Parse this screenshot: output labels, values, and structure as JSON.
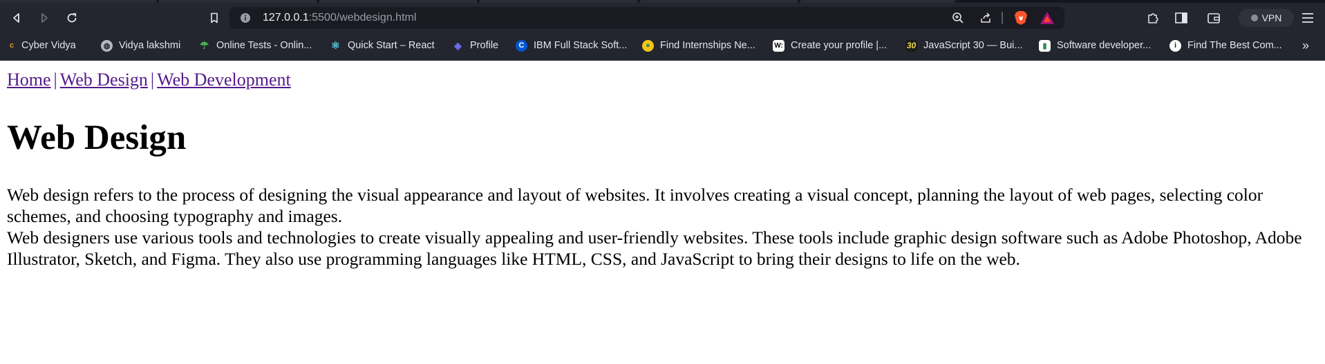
{
  "browser": {
    "url_host": "127.0.0.1",
    "url_path": ":5500/webdesign.html",
    "vpn_label": "VPN",
    "icons": [
      "back-icon",
      "forward-icon",
      "reload-icon",
      "bookmark-icon",
      "site-info-icon",
      "zoom-icon",
      "share-icon",
      "brave-shields-icon",
      "brave-rewards-icon",
      "extensions-icon",
      "sidebar-icon",
      "wallet-icon",
      "menu-icon"
    ],
    "bookmarks": [
      {
        "label": "Cyber Vidya",
        "icon": "cybervidya-icon",
        "color": "#e0a030"
      },
      {
        "label": "Vidya lakshmi",
        "icon": "globe-icon",
        "color": "#b5b7c0"
      },
      {
        "label": "Online Tests - Onlin...",
        "icon": "onlinetests-icon",
        "color": "#4caf50"
      },
      {
        "label": "Quick Start – React",
        "icon": "react-icon",
        "color": "#58c4dc"
      },
      {
        "label": "Profile",
        "icon": "profile-icon",
        "color": "#6d6ff5"
      },
      {
        "label": "IBM Full Stack Soft...",
        "icon": "coursera-icon",
        "color": "#0056d2"
      },
      {
        "label": "Find Internships Ne...",
        "icon": "internshala-icon",
        "color": "#f5c518"
      },
      {
        "label": "Create your profile |...",
        "icon": "wellfound-icon",
        "color": "#ffffff"
      },
      {
        "label": "JavaScript 30 — Bui...",
        "icon": "js30-icon",
        "color": "#f0db4f"
      },
      {
        "label": "Software developer...",
        "icon": "indeed-icon",
        "color": "#2e8b57"
      },
      {
        "label": "Find The Best Com...",
        "icon": "info-icon",
        "color": "#ffffff"
      }
    ],
    "more_label": "»"
  },
  "page": {
    "nav": {
      "home": "Home",
      "web_design": "Web Design",
      "web_development": "Web Development",
      "separator": "|"
    },
    "title": "Web Design",
    "paragraph1": "Web design refers to the process of designing the visual appearance and layout of websites. It involves creating a visual concept, planning the layout of web pages, selecting color schemes, and choosing typography and images.",
    "paragraph2": "Web designers use various tools and technologies to create visually appealing and user-friendly websites. These tools include graphic design software such as Adobe Photoshop, Adobe Illustrator, Sketch, and Figma. They also use programming languages like HTML, CSS, and JavaScript to bring their designs to life on the web."
  }
}
